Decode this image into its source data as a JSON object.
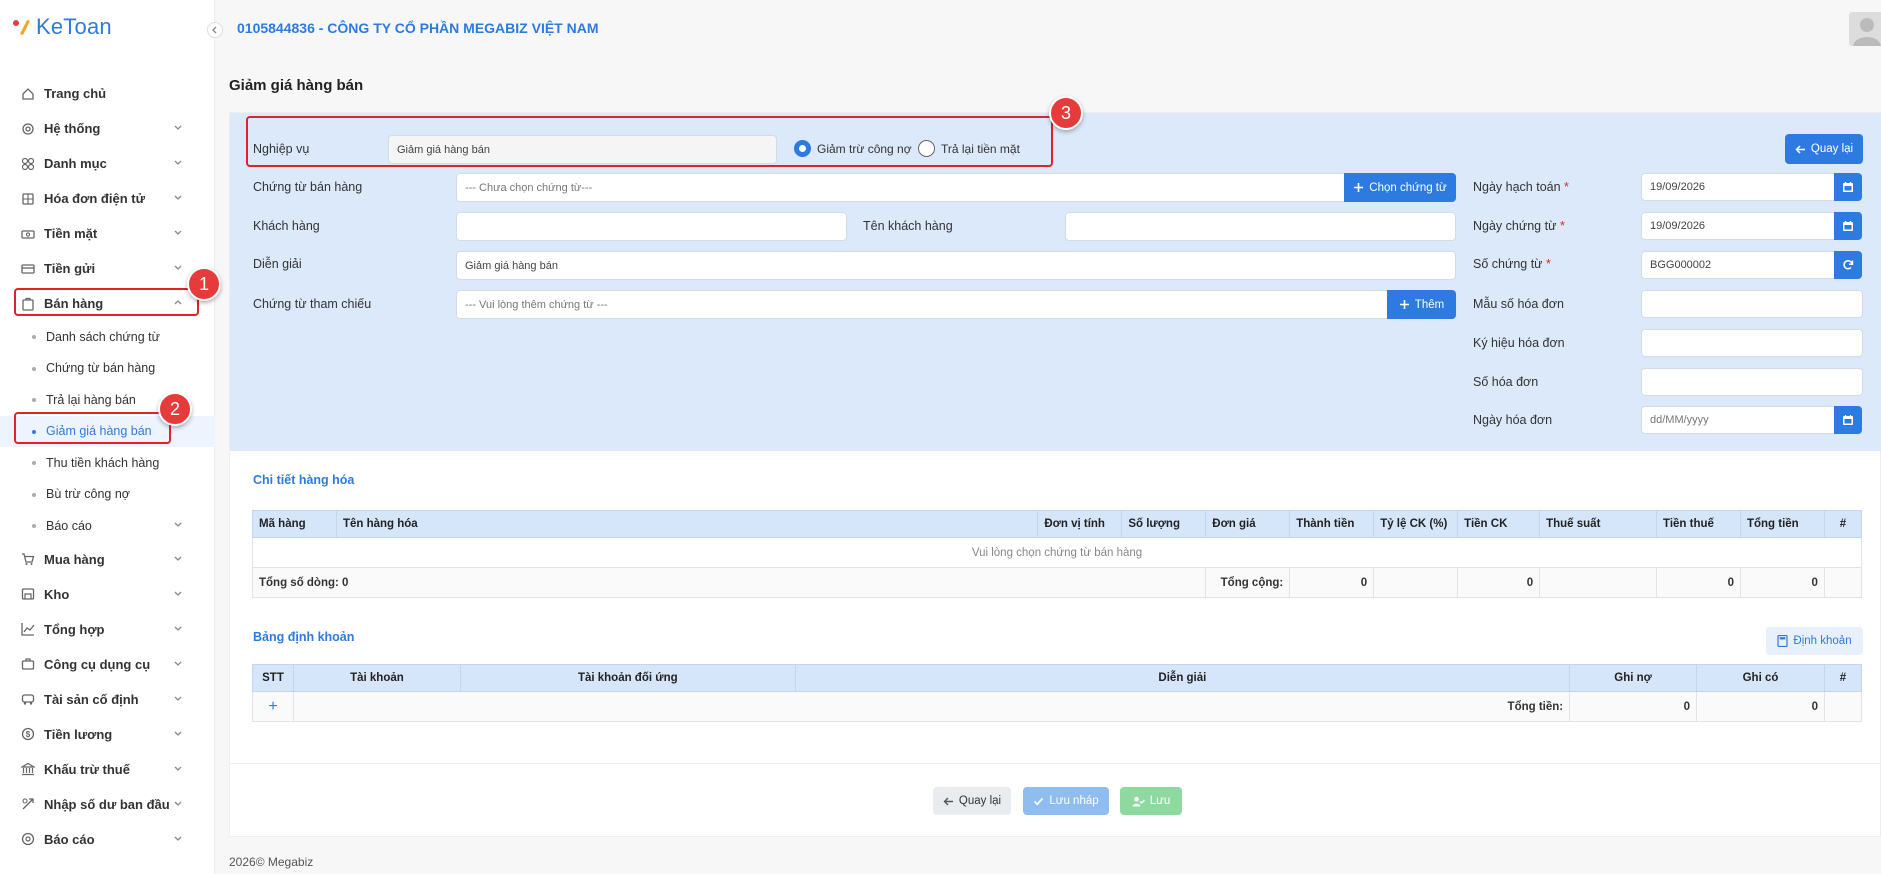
{
  "app": {
    "logo_text": "KeToan",
    "company": "0105844836 - CÔNG TY CỔ PHẦN MEGABIZ VIỆT NAM"
  },
  "sidebar": {
    "items": [
      {
        "label": "Trang chủ",
        "icon": "home-icon"
      },
      {
        "label": "Hệ thống",
        "icon": "gear-icon"
      },
      {
        "label": "Danh mục",
        "icon": "grid-icon"
      },
      {
        "label": "Hóa đơn điện tử",
        "icon": "invoice-icon"
      },
      {
        "label": "Tiền mặt",
        "icon": "cash-icon"
      },
      {
        "label": "Tiền gửi",
        "icon": "card-icon"
      },
      {
        "label": "Bán hàng",
        "icon": "sales-icon"
      },
      {
        "label": "Mua hàng",
        "icon": "cart-icon"
      },
      {
        "label": "Kho",
        "icon": "warehouse-icon"
      },
      {
        "label": "Tổng hợp",
        "icon": "chart-icon"
      },
      {
        "label": "Công cụ dụng cụ",
        "icon": "tools-icon"
      },
      {
        "label": "Tài sản cố định",
        "icon": "asset-icon"
      },
      {
        "label": "Tiền lương",
        "icon": "salary-icon"
      },
      {
        "label": "Khấu trừ thuế",
        "icon": "tax-icon"
      },
      {
        "label": "Nhập số dư ban đầu",
        "icon": "import-icon"
      },
      {
        "label": "Báo cáo",
        "icon": "report-icon"
      }
    ],
    "sales_sub": [
      "Danh sách chứng từ",
      "Chứng từ bán hàng",
      "Trả lại hàng bán",
      "Giảm giá hàng bán",
      "Thu tiền khách hàng",
      "Bù trừ công nợ",
      "Báo cáo"
    ]
  },
  "page": {
    "title": "Giảm giá hàng bán"
  },
  "form": {
    "nghiep_vu_label": "Nghiệp vụ",
    "nghiep_vu_value": "Giảm giá hàng bán",
    "radio1": "Giảm trừ công nợ",
    "radio2": "Trả lại tiền mặt",
    "back_btn": "Quay lại",
    "chung_tu_ban_hang_label": "Chứng từ bán hàng",
    "chung_tu_ban_hang_placeholder": "--- Chưa chọn chứng từ---",
    "chon_chung_tu_btn": "Chọn chứng từ",
    "khach_hang_label": "Khách hàng",
    "ten_khach_hang_label": "Tên khách hàng",
    "dien_giai_label": "Diễn giải",
    "dien_giai_value": "Giảm giá hàng bán",
    "tham_chieu_label": "Chứng từ tham chiếu",
    "tham_chieu_placeholder": "--- Vui lòng thêm chứng từ ---",
    "them_btn": "Thêm",
    "ngay_hach_toan_label": "Ngày hạch toán",
    "ngay_hach_toan": "19/09/2026",
    "ngay_chung_tu_label": "Ngày chứng từ",
    "ngay_chung_tu": "19/09/2026",
    "so_chung_tu_label": "Số chứng từ",
    "so_chung_tu": "BGG000002",
    "mau_so_label": "Mẫu số hóa đơn",
    "ky_hieu_label": "Ký hiệu hóa đơn",
    "so_hoa_don_label": "Số hóa đơn",
    "ngay_hoa_don_label": "Ngày hóa đơn",
    "ngay_hoa_don_placeholder": "dd/MM/yyyy",
    "required_mark": "*"
  },
  "goods": {
    "title": "Chi tiết hàng hóa",
    "columns": [
      "Mã hàng",
      "Tên hàng hóa",
      "Đơn vị tính",
      "Số lượng",
      "Đơn giá",
      "Thành tiền",
      "Tỷ lệ CK (%)",
      "Tiền CK",
      "Thuế suất",
      "Tiền thuế",
      "Tổng tiền",
      "#"
    ],
    "empty": "Vui lòng chọn chứng từ bán hàng",
    "rows_label": "Tổng số dòng: 0",
    "total_label": "Tổng cộng:",
    "thanh_tien": "0",
    "tien_ck": "0",
    "tien_thue": "0",
    "tong_tien": "0"
  },
  "entries": {
    "title": "Bảng định khoản",
    "btn": "Định khoản",
    "columns": [
      "STT",
      "Tài khoản",
      "Tài khoản đối ứng",
      "Diễn giải",
      "Ghi nợ",
      "Ghi có",
      "#"
    ],
    "add": "+",
    "total_label": "Tổng tiền:",
    "ghi_no": "0",
    "ghi_co": "0"
  },
  "actions": {
    "back": "Quay lại",
    "draft": "Lưu nháp",
    "save": "Lưu"
  },
  "badges": [
    "1",
    "2",
    "3"
  ],
  "footer": "2026© Megabiz",
  "colors": {
    "primary": "#2d7be0",
    "form_bg": "#dce9fa",
    "callout": "#e0222a",
    "draft": "#8fbdf0",
    "save": "#8ed9a0"
  }
}
